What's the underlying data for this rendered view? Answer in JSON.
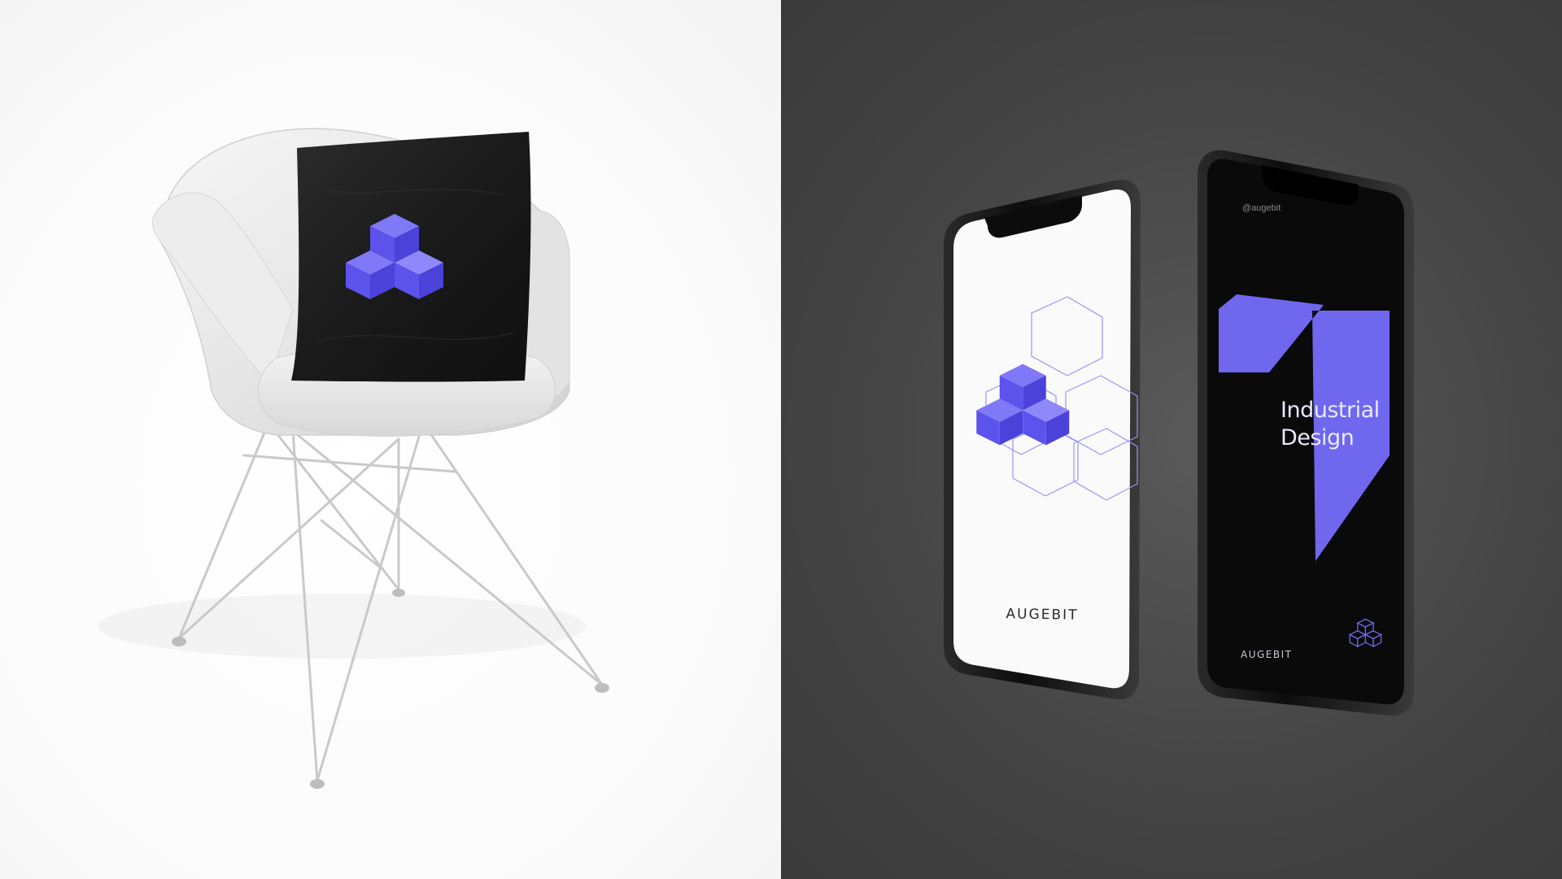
{
  "scene": {
    "left_background": "#ffffff",
    "right_background": "#454545",
    "accent_color": "#6b63f2"
  },
  "phone_light": {
    "brand": "AUGEBIT"
  },
  "phone_dark": {
    "handle": "@augebit",
    "title_line1": "Industrial",
    "title_line2": "Design",
    "brand": "AUGEBIT"
  }
}
